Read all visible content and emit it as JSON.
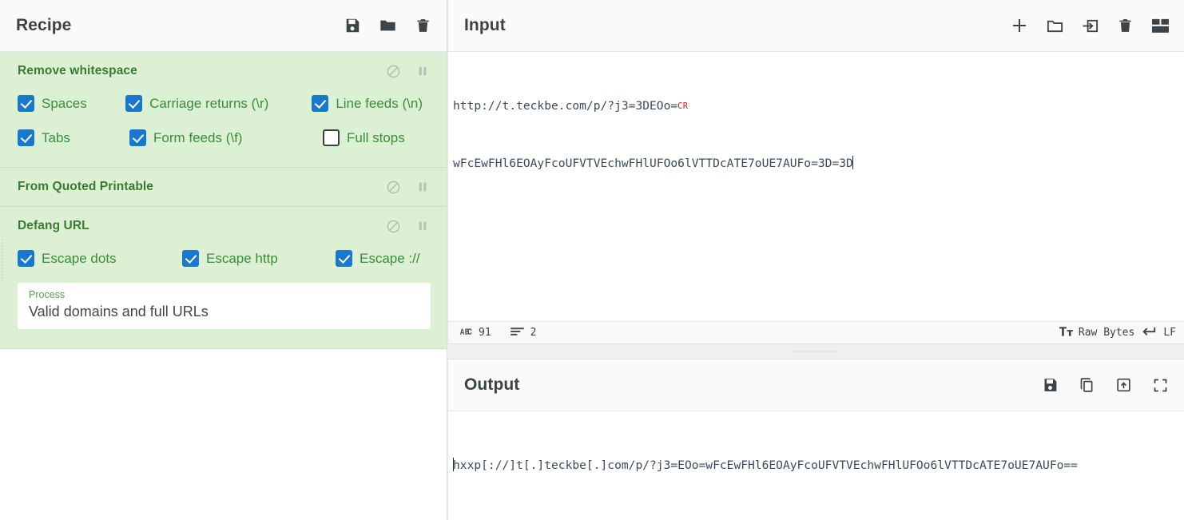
{
  "recipe": {
    "title": "Recipe",
    "title_icons": [
      {
        "name": "save-icon",
        "label": "Save recipe"
      },
      {
        "name": "folder-icon",
        "label": "Load recipe"
      },
      {
        "name": "trash-icon",
        "label": "Clear recipe"
      }
    ],
    "operations": [
      {
        "name": "Remove whitespace",
        "controls": [
          {
            "name": "disable-icon",
            "label": "Disable operation"
          },
          {
            "name": "pause-icon",
            "label": "Set breakpoint"
          }
        ],
        "checkbox_rows": [
          [
            {
              "label": "Spaces",
              "checked": true
            },
            {
              "label": "Carriage returns (\\r)",
              "checked": true
            },
            {
              "label": "Line feeds (\\n)",
              "checked": true
            }
          ],
          [
            {
              "label": "Tabs",
              "checked": true
            },
            {
              "label": "Form feeds (\\f)",
              "checked": true
            },
            {
              "label": "Full stops",
              "checked": false
            }
          ]
        ]
      },
      {
        "name": "From Quoted Printable",
        "controls": [
          {
            "name": "disable-icon",
            "label": "Disable operation"
          },
          {
            "name": "pause-icon",
            "label": "Set breakpoint"
          }
        ],
        "checkbox_rows": []
      },
      {
        "name": "Defang URL",
        "controls": [
          {
            "name": "disable-icon",
            "label": "Disable operation"
          },
          {
            "name": "pause-icon",
            "label": "Set breakpoint"
          }
        ],
        "checkbox_rows": [
          [
            {
              "label": "Escape dots",
              "checked": true
            },
            {
              "label": "Escape http",
              "checked": true
            },
            {
              "label": "Escape ://",
              "checked": true
            }
          ]
        ],
        "select": {
          "label": "Process",
          "value": "Valid domains and full URLs"
        }
      }
    ]
  },
  "input": {
    "title": "Input",
    "title_icons": [
      {
        "name": "add-icon",
        "label": "Add a new input tab"
      },
      {
        "name": "folder-open-icon",
        "label": "Open file as input"
      },
      {
        "name": "open-folder-as-input-icon",
        "label": "Open folder as input"
      },
      {
        "name": "trash-icon",
        "label": "Clear input and output"
      },
      {
        "name": "reset-layout-icon",
        "label": "Reset pane layout"
      }
    ],
    "lines": [
      {
        "text": "http://t.teckbe.com/p/?j3=3DEOo=",
        "control_char": "CR"
      },
      {
        "text": "wFcEwFHl6EOAyFcoUFVTVEchwFHlUFOo6lVTTDcATE7oUE7AUFo=3D=3D",
        "cursor_after": true
      }
    ],
    "status": {
      "length_icon": "abc-icon",
      "length": "91",
      "lines_icon": "lines-icon",
      "lines": "2",
      "font_icon": "font-size-icon",
      "input_format": "Raw Bytes",
      "line_ending_icon": "return-arrow-icon",
      "line_ending": "LF"
    }
  },
  "output": {
    "title": "Output",
    "title_icons": [
      {
        "name": "save-icon",
        "label": "Save output to file"
      },
      {
        "name": "copy-icon",
        "label": "Copy raw output to the clipboard"
      },
      {
        "name": "replace-input-icon",
        "label": "Replace input with output"
      },
      {
        "name": "maximize-icon",
        "label": "Maximise output pane"
      }
    ],
    "lines": [
      {
        "text": "hxxp[://]t[.]teckbe[.]com/p/?j3=EOo=wFcEwFHl6EOAyFcoUFVTVEchwFHlUFOo6lVTTDcATE7oUE7AUFo==",
        "cursor_before": true
      }
    ]
  },
  "colors": {
    "operation_background": "#dcf0d4",
    "operation_title": "#3a7a36",
    "checkbox_checked": "#1778d0",
    "checkbox_label": "#3a8c3c",
    "pane_title": "#3b4248",
    "control_char": "#cf2222"
  }
}
